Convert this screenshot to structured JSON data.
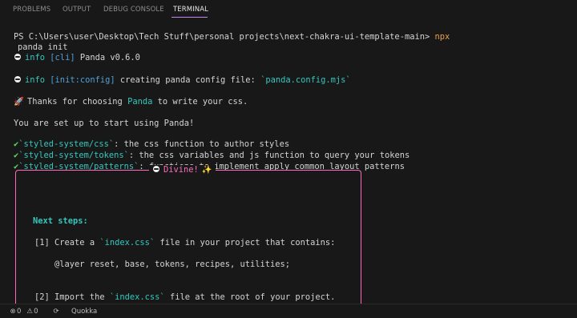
{
  "tabs": [
    {
      "label": "PROBLEMS",
      "active": false
    },
    {
      "label": "OUTPUT",
      "active": false
    },
    {
      "label": "DEBUG CONSOLE",
      "active": false
    },
    {
      "label": "TERMINAL",
      "active": true
    }
  ],
  "terminal": {
    "prompt": "PS C:\\Users\\user\\Desktop\\Tech Stuff\\personal projects\\next-chakra-ui-template-main>",
    "cmd_part1": "npx",
    "cmd_part2": "panda init",
    "l1_info": "info",
    "l1_tag": "[cli]",
    "l1_text": "Panda v0.6.0",
    "l2_info": "info",
    "l2_tag": "[init:config]",
    "l2_text": "creating panda config file:",
    "l2_file": "`panda.config.mjs`",
    "thanks_pre": "Thanks for choosing",
    "thanks_brand": "Panda",
    "thanks_post": "to write your css.",
    "setup": "You are set up to start using Panda!",
    "checks": [
      {
        "code": "`styled-system/css`",
        "desc": ": the css function to author styles"
      },
      {
        "code": "`styled-system/tokens`",
        "desc": ": the css variables and js function to query your tokens"
      },
      {
        "code": "`styled-system/patterns`",
        "desc": ": functions to implement apply common layout patterns"
      }
    ],
    "box_title": "Divine!",
    "next_steps": "Next steps:",
    "step1_pre": "[1] Create a",
    "step1_code": "`index.css`",
    "step1_post": "file in your project that contains:",
    "layer": "@layer reset, base, tokens, recipes, utilities;",
    "step2_pre": "[2] Import the",
    "step2_code": "`index.css`",
    "step2_post": "file at the root of your project."
  },
  "status": {
    "errors": "0",
    "warnings": "0",
    "extension": "Quokka"
  },
  "colors": {
    "accent": "#c586f0",
    "info": "#33c8be",
    "tag": "#4fa0dc",
    "box_border": "#ff6ac1"
  }
}
